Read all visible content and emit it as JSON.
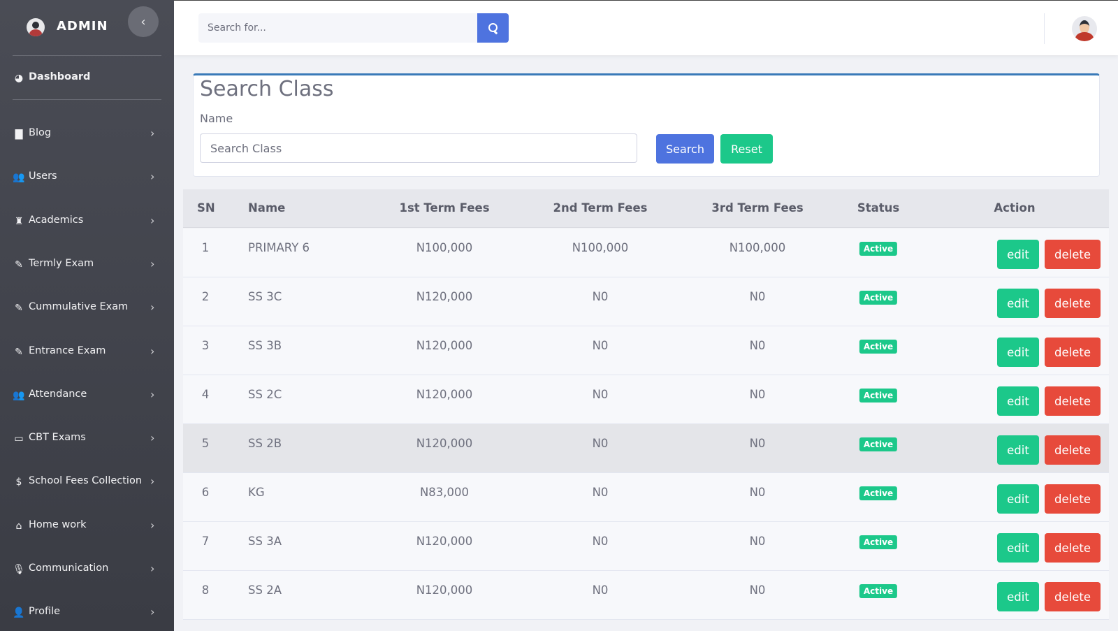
{
  "sidebar": {
    "brand": "ADMIN",
    "items": [
      {
        "label": "Dashboard",
        "icon": "dashboard-icon",
        "glyph": "◕"
      },
      {
        "label": "Blog",
        "icon": "book-icon",
        "glyph": "▇"
      },
      {
        "label": "Users",
        "icon": "users-icon",
        "glyph": "👥"
      },
      {
        "label": "Academics",
        "icon": "graduation-icon",
        "glyph": "♜"
      },
      {
        "label": "Termly Exam",
        "icon": "pencil-icon",
        "glyph": "✎"
      },
      {
        "label": "Cummulative Exam",
        "icon": "pencil-icon",
        "glyph": "✎"
      },
      {
        "label": "Entrance Exam",
        "icon": "pencil-icon",
        "glyph": "✎"
      },
      {
        "label": "Attendance",
        "icon": "users-icon",
        "glyph": "👥"
      },
      {
        "label": "CBT Exams",
        "icon": "laptop-icon",
        "glyph": "▭"
      },
      {
        "label": "School Fees Collection",
        "icon": "dollar-icon",
        "glyph": "$"
      },
      {
        "label": "Home work",
        "icon": "home-icon",
        "glyph": "⌂"
      },
      {
        "label": "Communication",
        "icon": "microphone-icon",
        "glyph": "🎙"
      },
      {
        "label": "Profile",
        "icon": "user-icon",
        "glyph": "👤"
      }
    ]
  },
  "topbar": {
    "search_placeholder": "Search for..."
  },
  "search_card": {
    "title": "Search Class",
    "field_label": "Name",
    "input_placeholder": "Search Class",
    "search_label": "Search",
    "reset_label": "Reset"
  },
  "table": {
    "headers": [
      "SN",
      "Name",
      "1st Term Fees",
      "2nd Term Fees",
      "3rd Term Fees",
      "Status",
      "Action"
    ],
    "edit_label": "edit",
    "delete_label": "delete",
    "rows": [
      {
        "sn": "1",
        "name": "PRIMARY 6",
        "t1": "N100,000",
        "t2": "N100,000",
        "t3": "N100,000",
        "status": "Active"
      },
      {
        "sn": "2",
        "name": "SS 3C",
        "t1": "N120,000",
        "t2": "N0",
        "t3": "N0",
        "status": "Active"
      },
      {
        "sn": "3",
        "name": "SS 3B",
        "t1": "N120,000",
        "t2": "N0",
        "t3": "N0",
        "status": "Active"
      },
      {
        "sn": "4",
        "name": "SS 2C",
        "t1": "N120,000",
        "t2": "N0",
        "t3": "N0",
        "status": "Active"
      },
      {
        "sn": "5",
        "name": "SS 2B",
        "t1": "N120,000",
        "t2": "N0",
        "t3": "N0",
        "status": "Active"
      },
      {
        "sn": "6",
        "name": "KG",
        "t1": "N83,000",
        "t2": "N0",
        "t3": "N0",
        "status": "Active"
      },
      {
        "sn": "7",
        "name": "SS 3A",
        "t1": "N120,000",
        "t2": "N0",
        "t3": "N0",
        "status": "Active"
      },
      {
        "sn": "8",
        "name": "SS 2A",
        "t1": "N120,000",
        "t2": "N0",
        "t3": "N0",
        "status": "Active"
      }
    ]
  },
  "colors": {
    "primary": "#4e73df",
    "success": "#1cc88a",
    "danger": "#e74a3b",
    "sidebar": "#43454d"
  }
}
